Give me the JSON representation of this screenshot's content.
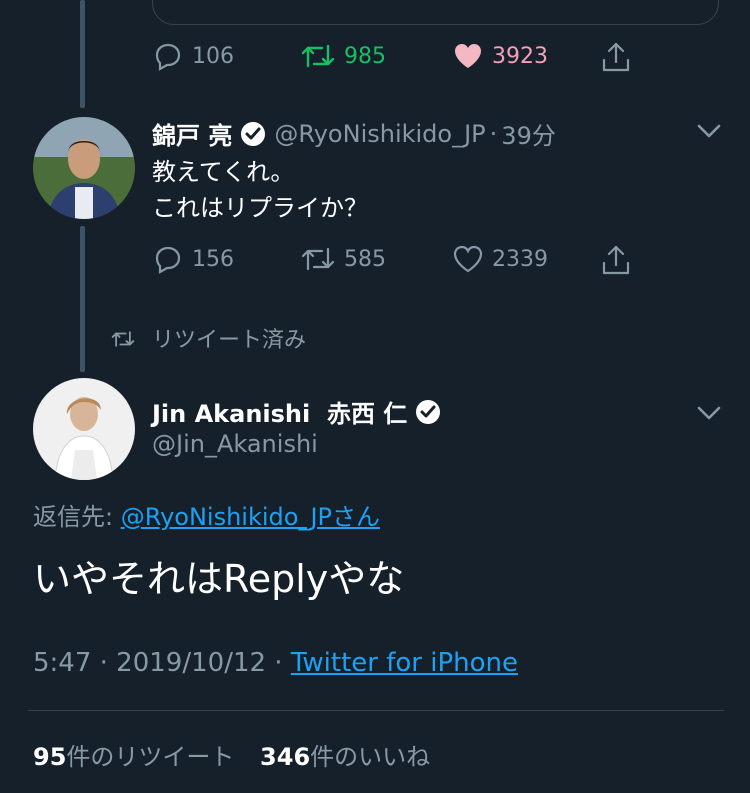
{
  "tweet1": {
    "replies": "106",
    "retweets": "985",
    "likes": "3923",
    "colors": {
      "retweeted": "#17bf63",
      "liked": "#e0245e",
      "liked_heart": "#f4b7c4"
    }
  },
  "tweet2": {
    "display_name": "錦戸 亮",
    "handle": "@RyoNishikido_JP",
    "separator": "·",
    "time": "39分",
    "lines": [
      "教えてくれ。",
      "これはリプライか？"
    ],
    "replies": "156",
    "retweets": "585",
    "likes": "2339"
  },
  "retweet_notice": "リツイート済み",
  "main": {
    "display_name": "Jin Akanishi  赤西 仁",
    "handle": "@Jin_Akanishi",
    "reply_to_label": "返信先: ",
    "reply_to_link": "@RyoNishikido_JPさん",
    "text": "いやそれはReplyやな",
    "timestamp": "5:47 · 2019/10/12 · ",
    "source": "Twitter for iPhone",
    "retweet_count": "95",
    "retweet_label": "件のリツイート",
    "like_count": "346",
    "like_label": "件のいいね"
  },
  "icons": [
    "reply-icon",
    "retweet-icon",
    "like-icon",
    "share-icon",
    "verified-icon",
    "chevron-down-icon"
  ],
  "accent": "#1da1f2",
  "background": "#15202b"
}
